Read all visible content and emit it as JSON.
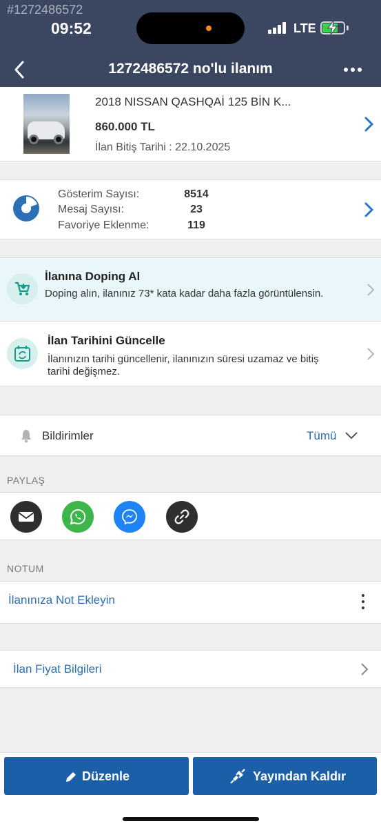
{
  "status_bar": {
    "overlay_id": "#1272486572",
    "time": "09:52",
    "network": "LTE"
  },
  "nav": {
    "title": "1272486572 no'lu ilanım"
  },
  "listing": {
    "title": "2018 NISSAN QASHQAİ 125 BİN K...",
    "price": "860.000 TL",
    "end_date_label": "İlan Bitiş Tarihi : 22.10.2025"
  },
  "stats": [
    {
      "label": "Gösterim Sayısı:",
      "value": "8514"
    },
    {
      "label": "Mesaj Sayısı:",
      "value": "23"
    },
    {
      "label": "Favoriye Eklenme:",
      "value": "119"
    }
  ],
  "doping": {
    "title": "İlanına Doping Al",
    "description": "Doping alın, ilanınız 73* kata kadar daha fazla görüntülensin."
  },
  "update_date": {
    "title": "İlan Tarihini Güncelle",
    "description_line1": "İlanınızın tarihi güncellenir, ilanınızın süresi uzamaz ve bitiş",
    "description_line2": "tarihi değişmez."
  },
  "notifications": {
    "label": "Bildirimler",
    "selected": "Tümü"
  },
  "share": {
    "section_label": "PAYLAŞ",
    "buttons": [
      {
        "icon": "mail-icon",
        "color": "#2f2f2f"
      },
      {
        "icon": "whatsapp-icon",
        "color": "#3cb54a"
      },
      {
        "icon": "messenger-icon",
        "color": "#1e84f5"
      },
      {
        "icon": "link-icon",
        "color": "#2f2f2f"
      }
    ]
  },
  "note": {
    "section_label": "NOTUM",
    "add_label": "İlanınıza Not Ekleyin"
  },
  "price_info": {
    "label": "İlan Fiyat Bilgileri"
  },
  "actions": {
    "edit": "Düzenle",
    "unpublish": "Yayından Kaldır"
  },
  "colors": {
    "header": "#3b4660",
    "accent_blue": "#1b5fa9",
    "link_blue": "#2a6db3",
    "doping_bg": "#e9f7fa"
  }
}
